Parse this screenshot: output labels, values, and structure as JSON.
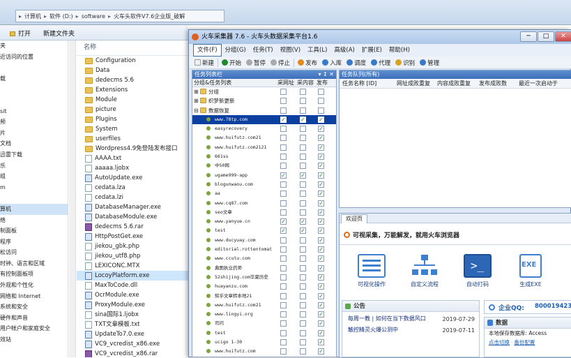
{
  "explorer": {
    "breadcrumb": [
      "计算机",
      "软件 (D:)",
      "software",
      "火车头软件V7.6企业版_破解"
    ],
    "toolbar": {
      "open": "打开",
      "new_folder": "新建文件夹"
    },
    "nav_items": [
      "夹",
      "近访问的位置",
      "",
      "载",
      "",
      "",
      "sit",
      "频",
      "片",
      "文档",
      "迅雷下载",
      "乐",
      "组",
      "m",
      "",
      "算机",
      "络",
      "制面板",
      "程序",
      "松访问",
      "时钟、语言和区域",
      "有控制面板项",
      "外观和个性化",
      "网络和 Internet",
      "系统和安全",
      "硬件和声音",
      "用户帐户和家庭安全",
      "效站"
    ],
    "column_header": "名称",
    "files": [
      {
        "name": "Configuration",
        "type": "folder"
      },
      {
        "name": "Data",
        "type": "folder"
      },
      {
        "name": "dedecms 5.6",
        "type": "folder"
      },
      {
        "name": "Extensions",
        "type": "folder"
      },
      {
        "name": "Module",
        "type": "folder"
      },
      {
        "name": "picture",
        "type": "folder"
      },
      {
        "name": "Plugins",
        "type": "folder"
      },
      {
        "name": "System",
        "type": "folder"
      },
      {
        "name": "userfiles",
        "type": "folder"
      },
      {
        "name": "Wordpress4.9免登陆发布接口",
        "type": "folder"
      },
      {
        "name": "AAAA.txt",
        "type": "file"
      },
      {
        "name": "aaaaa.ljobx",
        "type": "file"
      },
      {
        "name": "AutoUpdate.exe",
        "type": "exe"
      },
      {
        "name": "cedata.lza",
        "type": "file"
      },
      {
        "name": "cedata.lzi",
        "type": "file"
      },
      {
        "name": "DatabaseManager.exe",
        "type": "exe"
      },
      {
        "name": "DatabaseModule.exe",
        "type": "exe"
      },
      {
        "name": "dedecms 5.6.rar",
        "type": "rar"
      },
      {
        "name": "HttpPostGet.exe",
        "type": "exe"
      },
      {
        "name": "jiekou_gbk.php",
        "type": "file"
      },
      {
        "name": "jiekou_utf8.php",
        "type": "file"
      },
      {
        "name": "LEXICONC.MTX",
        "type": "file"
      },
      {
        "name": "LocoyPlatform.exe",
        "type": "exe"
      },
      {
        "name": "MaxToCode.dll",
        "type": "file"
      },
      {
        "name": "OcrModule.exe",
        "type": "exe"
      },
      {
        "name": "ProxyModule.exe",
        "type": "exe"
      },
      {
        "name": "sina国际1.ljobx",
        "type": "file"
      },
      {
        "name": "TXT文章模板.txt",
        "type": "file"
      },
      {
        "name": "UpdateTo7.0.exe",
        "type": "exe"
      },
      {
        "name": "VC9_vcredist_x86.exe",
        "type": "exe"
      },
      {
        "name": "VC9_vcredist_x86.rar",
        "type": "rar"
      }
    ],
    "selected_file_index": 22
  },
  "app": {
    "title": "火车采集器 7.6 - 火车头数据采集平台1.6",
    "window_buttons": {
      "min": "─",
      "max": "□",
      "close": "✕"
    },
    "menu": [
      "文件(F)",
      "分组(G)",
      "任务(T)",
      "视图(V)",
      "工具(L)",
      "高级(A)",
      "扩展(E)",
      "帮助(H)"
    ],
    "toolbar": [
      "新建",
      "开始",
      "暂停",
      "停止",
      "发布",
      "入库",
      "调度",
      "代理",
      "识别",
      "管理"
    ],
    "tree_panel": {
      "header": "任务列表栏",
      "pin": "▾ ↕ ✕",
      "col_group": "分组&任务列表",
      "col_collect": "采网址",
      "col_content": "采内容",
      "col_publish": "发布",
      "rows": [
        {
          "label": "分组",
          "type": "group",
          "c": [
            false,
            false,
            false
          ]
        },
        {
          "label": "织梦新更新",
          "type": "group",
          "c": [
            false,
            false,
            false
          ]
        },
        {
          "label": "数据恢复",
          "type": "group",
          "c": [
            false,
            false,
            false
          ]
        },
        {
          "label": "www.78tp.com",
          "type": "task",
          "c": [
            true,
            true,
            true
          ]
        },
        {
          "label": "easyrecovery",
          "type": "task",
          "c": [
            false,
            false,
            true
          ]
        },
        {
          "label": "www.huifutz.com21",
          "type": "task",
          "c": [
            false,
            false,
            true
          ]
        },
        {
          "label": "www.huifutz.com2121",
          "type": "task",
          "c": [
            false,
            false,
            true
          ]
        },
        {
          "label": "661ss",
          "type": "task",
          "c": [
            false,
            false,
            true
          ]
        },
        {
          "label": "中50网",
          "type": "task",
          "c": [
            false,
            false,
            true
          ]
        },
        {
          "label": "ugame999-app",
          "type": "task",
          "c": [
            true,
            true,
            true
          ]
        },
        {
          "label": "blogunwaou.com",
          "type": "task",
          "c": [
            false,
            false,
            true
          ]
        },
        {
          "label": "aa",
          "type": "task",
          "c": [
            false,
            false,
            true
          ]
        },
        {
          "label": "www.cq87.com",
          "type": "task",
          "c": [
            false,
            false,
            true
          ]
        },
        {
          "label": "seo文章",
          "type": "task",
          "c": [
            false,
            false,
            true
          ]
        },
        {
          "label": "www.yanyue.cn",
          "type": "task",
          "c": [
            true,
            true,
            true
          ]
        },
        {
          "label": "test",
          "type": "task",
          "c": [
            true,
            true,
            true
          ]
        },
        {
          "label": "www.ducyuay.com",
          "type": "task",
          "c": [
            false,
            false,
            true
          ]
        },
        {
          "label": "editorial.rottentomat",
          "type": "task",
          "c": [
            false,
            false,
            true
          ]
        },
        {
          "label": "www.ccutu.com",
          "type": "task",
          "c": [
            false,
            false,
            true
          ]
        },
        {
          "label": "典图执业药师",
          "type": "task",
          "c": [
            false,
            false,
            true
          ]
        },
        {
          "label": "52shijing.com华夏历史",
          "type": "task",
          "c": [
            false,
            false,
            true
          ]
        },
        {
          "label": "huayanzu.com",
          "type": "task",
          "c": [
            false,
            false,
            true
          ]
        },
        {
          "label": "知乎文章转本地21",
          "type": "task",
          "c": [
            false,
            false,
            true
          ]
        },
        {
          "label": "www.huifutz.com21",
          "type": "task",
          "c": [
            false,
            false,
            true
          ]
        },
        {
          "label": "www.lingyi.org",
          "type": "task",
          "c": [
            false,
            false,
            true
          ]
        },
        {
          "label": "司问",
          "type": "task",
          "c": [
            false,
            false,
            true
          ]
        },
        {
          "label": "test",
          "type": "task",
          "c": [
            false,
            false,
            true
          ]
        },
        {
          "label": "ucigo 1-30",
          "type": "task",
          "c": [
            false,
            false,
            true
          ]
        },
        {
          "label": "www.huifutz.com",
          "type": "task",
          "c": [
            false,
            false,
            true
          ]
        }
      ]
    },
    "queue_panel": {
      "header": "任务队列(所有)",
      "columns": [
        "任务名称 [ID]",
        "网址成败重复",
        "内容成败重复",
        "发布成败数",
        "最近一次启动于"
      ]
    },
    "welcome": {
      "tab": "欢迎页",
      "slogan": "可视采集，万能解发，就用火车浏览器",
      "features": [
        "可视化操作",
        "自定义流程",
        "自动打码",
        "生成EXE"
      ],
      "notice": {
        "title": "公告",
        "items": [
          {
            "text": "每周一教 | 如何在当下数据风口",
            "date": "2019-07-29"
          },
          {
            "text": "触控精灵火爆公测中",
            "date": "2019-07-11"
          }
        ]
      },
      "qq": {
        "label": "企业QQ:",
        "number": "800019423"
      },
      "data": {
        "title": "数据",
        "db_label": "本地保存数据库:",
        "db_value": "Access",
        "links": [
          "点击切换",
          "备份配置"
        ]
      }
    }
  }
}
